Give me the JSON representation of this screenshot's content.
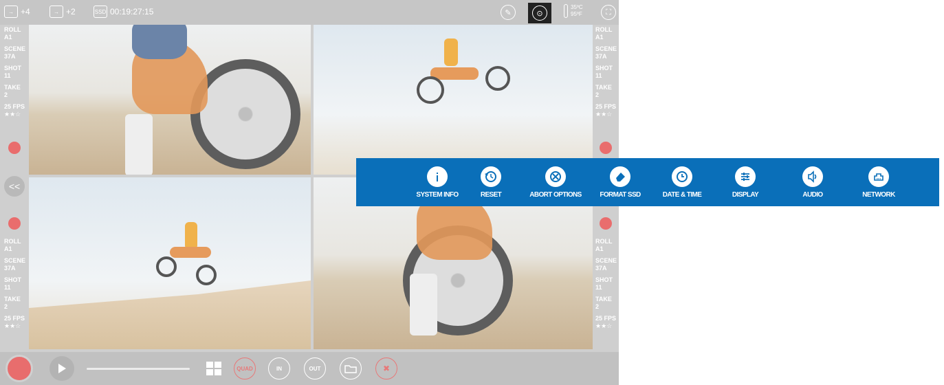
{
  "topbar": {
    "output_a": "+4",
    "output_b": "+2",
    "media_label": "SSD",
    "timecode": "00:19:27:15",
    "temp_c": "35ºC",
    "temp_f": "95ºF",
    "icons": [
      "output-arrow-icon",
      "output-arrow-icon",
      "ssd-icon",
      "wrench-icon",
      "settings-icon",
      "thermometer-icon",
      "fullscreen-icon"
    ]
  },
  "clip_meta": {
    "roll_label": "ROLL",
    "roll_value": "A1",
    "scene_label": "SCENE",
    "scene_value": "37A",
    "shot_label": "SHOT",
    "shot_value": "11",
    "take_label": "TAKE",
    "take_value": "2",
    "fps": "25 FPS",
    "stars": "★★☆"
  },
  "collapse_label": "<<",
  "bottombar": {
    "quad_label": "QUAD",
    "in_label": "IN",
    "out_label": "OUT",
    "close_symbol": "✖"
  },
  "menu": {
    "background": "#0a6fb9",
    "items": [
      {
        "label": "SYSTEM INFO",
        "icon": "info-icon"
      },
      {
        "label": "RESET",
        "icon": "reset-icon"
      },
      {
        "label": "ABORT OPTIONS",
        "icon": "abort-icon"
      },
      {
        "label": "FORMAT SSD",
        "icon": "eraser-icon"
      },
      {
        "label": "DATE & TIME",
        "icon": "clock-icon"
      },
      {
        "label": "DISPLAY",
        "icon": "sliders-icon"
      },
      {
        "label": "AUDIO",
        "icon": "speaker-icon"
      },
      {
        "label": "NETWORK",
        "icon": "network-icon"
      }
    ]
  }
}
